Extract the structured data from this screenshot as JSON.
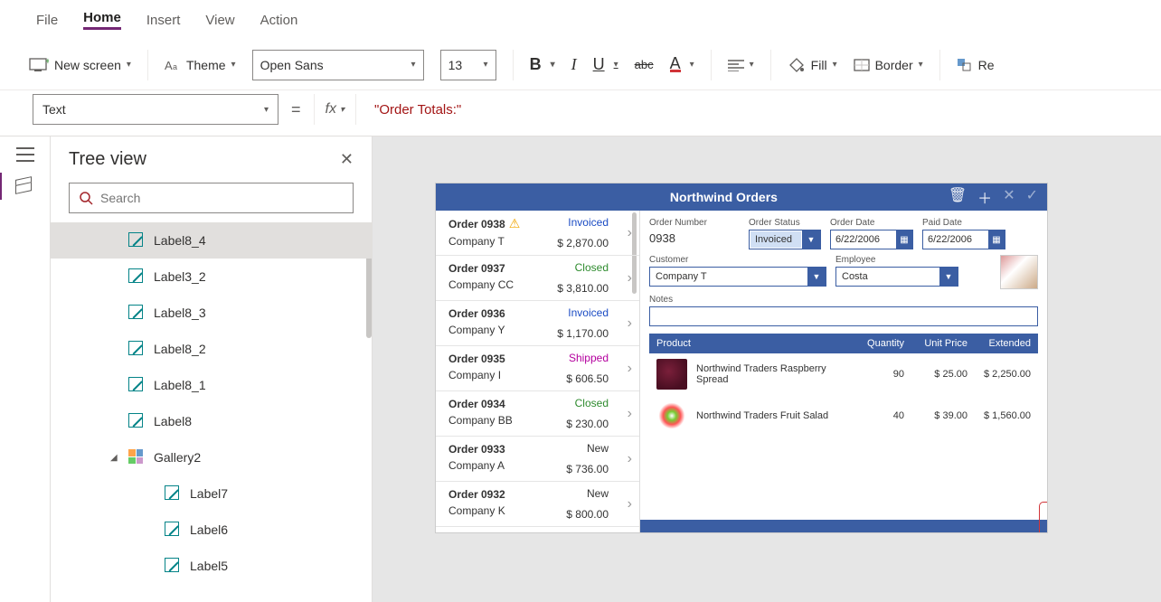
{
  "menu": {
    "tabs": [
      "File",
      "Home",
      "Insert",
      "View",
      "Action"
    ],
    "active": "Home"
  },
  "ribbon": {
    "new_screen": "New screen",
    "theme": "Theme",
    "font": "Open Sans",
    "size": "13",
    "fill": "Fill",
    "border": "Border",
    "reorder": "Re"
  },
  "formula": {
    "property": "Text",
    "fx_label": "fx",
    "value": "\"Order Totals:\""
  },
  "tree": {
    "title": "Tree view",
    "search_placeholder": "Search",
    "items": [
      {
        "label": "Label8_4",
        "kind": "label",
        "selected": true,
        "indent": 0
      },
      {
        "label": "Label3_2",
        "kind": "label",
        "indent": 0
      },
      {
        "label": "Label8_3",
        "kind": "label",
        "indent": 0
      },
      {
        "label": "Label8_2",
        "kind": "label",
        "indent": 0
      },
      {
        "label": "Label8_1",
        "kind": "label",
        "indent": 0
      },
      {
        "label": "Label8",
        "kind": "label",
        "indent": 0
      },
      {
        "label": "Gallery2",
        "kind": "gallery",
        "indent": 0,
        "expanded": true
      },
      {
        "label": "Label7",
        "kind": "label",
        "indent": 1
      },
      {
        "label": "Label6",
        "kind": "label",
        "indent": 1
      },
      {
        "label": "Label5",
        "kind": "label",
        "indent": 1
      }
    ]
  },
  "app": {
    "title": "Northwind Orders",
    "orders": [
      {
        "id": "Order 0938",
        "company": "Company T",
        "status": "Invoiced",
        "status_class": "invoiced",
        "amount": "$ 2,870.00",
        "warn": true
      },
      {
        "id": "Order 0937",
        "company": "Company CC",
        "status": "Closed",
        "status_class": "closed",
        "amount": "$ 3,810.00"
      },
      {
        "id": "Order 0936",
        "company": "Company Y",
        "status": "Invoiced",
        "status_class": "invoiced",
        "amount": "$ 1,170.00"
      },
      {
        "id": "Order 0935",
        "company": "Company I",
        "status": "Shipped",
        "status_class": "shipped",
        "amount": "$ 606.50"
      },
      {
        "id": "Order 0934",
        "company": "Company BB",
        "status": "Closed",
        "status_class": "closed",
        "amount": "$ 230.00"
      },
      {
        "id": "Order 0933",
        "company": "Company A",
        "status": "New",
        "status_class": "new",
        "amount": "$ 736.00"
      },
      {
        "id": "Order 0932",
        "company": "Company K",
        "status": "New",
        "status_class": "new",
        "amount": "$ 800.00"
      }
    ],
    "detail": {
      "labels": {
        "order_number": "Order Number",
        "order_status": "Order Status",
        "order_date": "Order Date",
        "paid_date": "Paid Date",
        "customer": "Customer",
        "employee": "Employee",
        "notes": "Notes"
      },
      "order_number": "0938",
      "order_status": "Invoiced",
      "order_date": "6/22/2006",
      "paid_date": "6/22/2006",
      "customer": "Company T",
      "employee": "Costa",
      "notes": ""
    },
    "products": {
      "headers": {
        "product": "Product",
        "qty": "Quantity",
        "unit": "Unit Price",
        "ext": "Extended"
      },
      "rows": [
        {
          "name": "Northwind Traders Raspberry Spread",
          "qty": "90",
          "unit": "$ 25.00",
          "ext": "$ 2,250.00",
          "img": "p1"
        },
        {
          "name": "Northwind Traders Fruit Salad",
          "qty": "40",
          "unit": "$ 39.00",
          "ext": "$ 1,560.00",
          "img": "p2"
        }
      ]
    },
    "selected_label_text": "Order Totals:"
  }
}
